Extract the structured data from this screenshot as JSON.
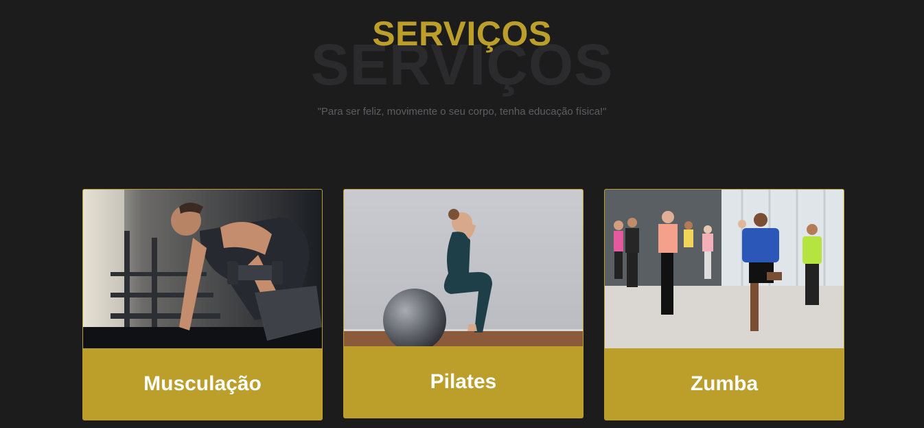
{
  "services": {
    "title": "SERVIÇOS",
    "background_title": "SERVIÇOS",
    "quote": "\"Para ser feliz, movimente o seu corpo, tenha educação física!\"",
    "cards": [
      {
        "label": "Musculação",
        "image": "weightlifting-photo"
      },
      {
        "label": "Pilates",
        "image": "pilates-ball-photo"
      },
      {
        "label": "Zumba",
        "image": "zumba-class-photo"
      }
    ]
  },
  "colors": {
    "background": "#1c1c1d",
    "accent": "#bc9e2b",
    "card_text": "#ffffff",
    "quote_text": "#5e5e60"
  }
}
